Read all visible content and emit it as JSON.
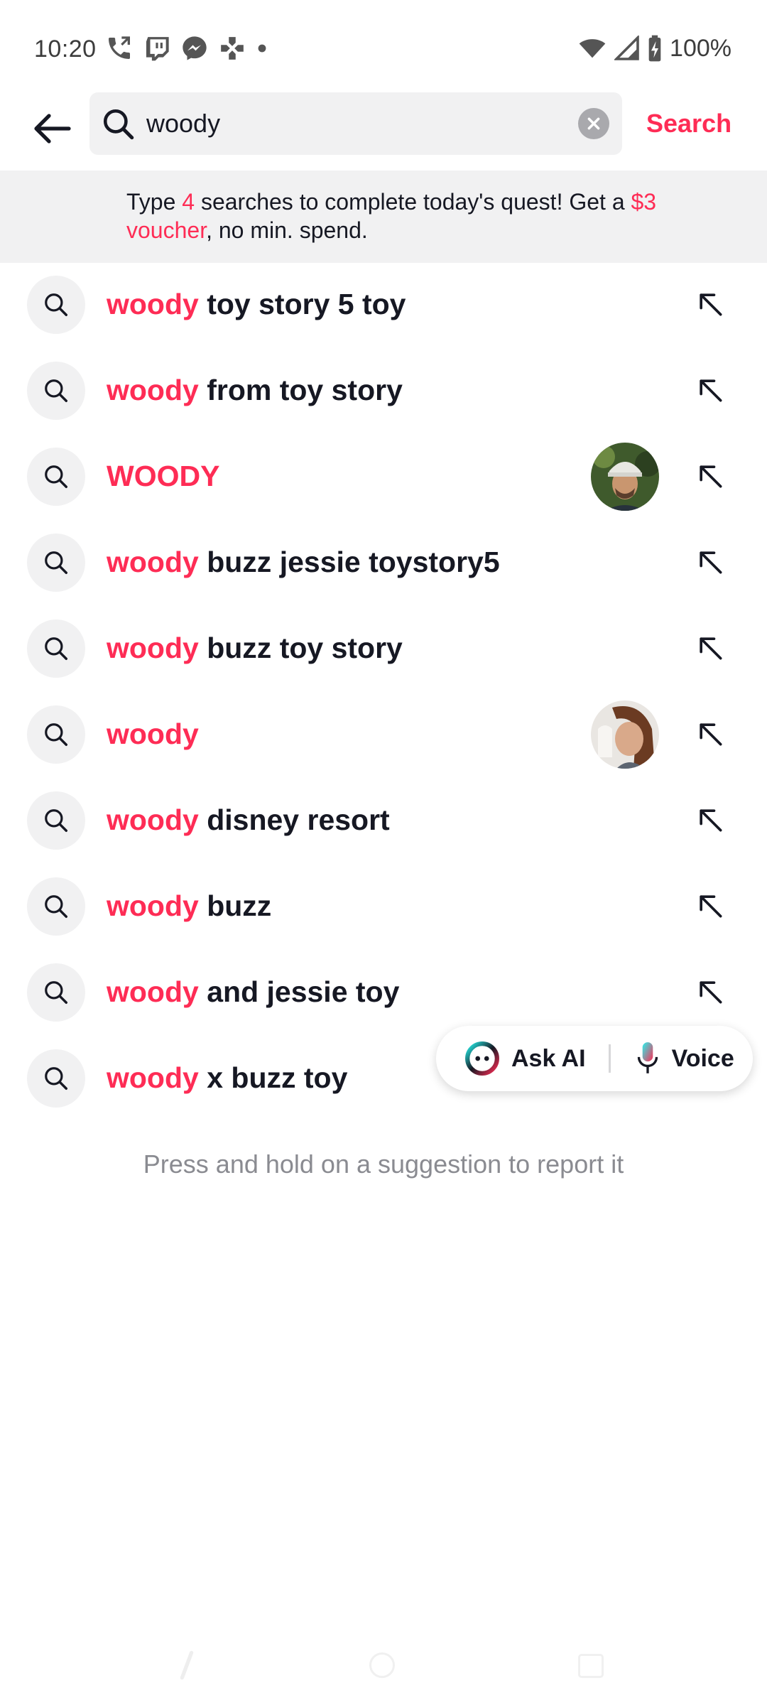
{
  "status_bar": {
    "time": "10:20",
    "left_icons": [
      "phone-call-icon",
      "twitch-icon",
      "messenger-icon",
      "gamepad-icon",
      "dot-icon"
    ],
    "right_icons": [
      "wifi-icon",
      "signal-icon",
      "battery-charging-icon"
    ],
    "battery": "100%"
  },
  "search": {
    "query": "woody",
    "search_label": "Search"
  },
  "quest": {
    "prefix": "Type ",
    "count": "4",
    "middle": " searches to complete today's quest! Get a ",
    "reward": "$3 voucher",
    "suffix": ", no min. spend."
  },
  "suggestions": [
    {
      "keyword": "woody",
      "rest": " toy story 5 toy"
    },
    {
      "keyword": "woody",
      "rest": " from toy story"
    },
    {
      "keyword": "WOODY",
      "rest": ""
    },
    {
      "keyword": "woody",
      "rest": " buzz jessie toystory5"
    },
    {
      "keyword": "woody",
      "rest": " buzz toy story"
    },
    {
      "keyword": "woody",
      "rest": ""
    },
    {
      "keyword": "woody",
      "rest": " disney resort"
    },
    {
      "keyword": "woody",
      "rest": " buzz"
    },
    {
      "keyword": "woody",
      "rest": " and jessie toy"
    },
    {
      "keyword": "woody",
      "rest": " x buzz toy"
    }
  ],
  "floating": {
    "ask_ai_label": "Ask AI",
    "voice_label": "Voice"
  },
  "report_hint": "Press and hold on a suggestion to report it",
  "colors": {
    "accent": "#fe2c55",
    "surface": "#f1f1f2",
    "text": "#161823",
    "muted": "#8a8b91"
  }
}
